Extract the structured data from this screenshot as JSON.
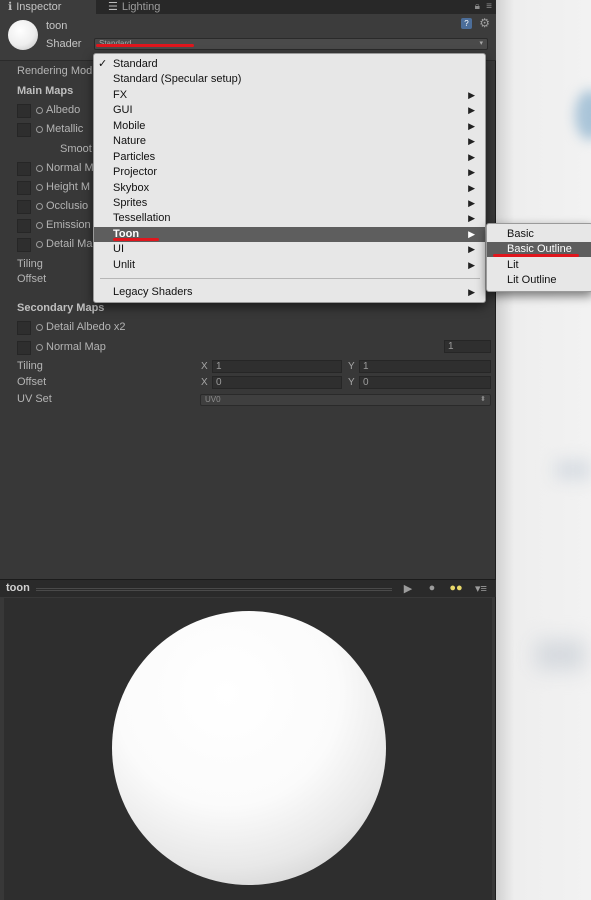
{
  "tabs": [
    {
      "label": "Inspector",
      "icon": "info-icon"
    },
    {
      "label": "Lighting",
      "icon": "lighting-icon"
    }
  ],
  "material": {
    "name": "toon",
    "shader_label": "Shader",
    "shader_value": "Standard"
  },
  "properties": {
    "rendering_mode": "Rendering Mod",
    "main_maps_title": "Main Maps",
    "albedo": "Albedo",
    "metallic": "Metallic",
    "smoothness": "Smoot",
    "normal_map": "Normal M",
    "height_map": "Height M",
    "occlusion": "Occlusio",
    "emission": "Emission",
    "detail_mask": "Detail Ma",
    "tiling": "Tiling",
    "offset": "Offset"
  },
  "secondary": {
    "title": "Secondary Maps",
    "detail_albedo": "Detail Albedo x2",
    "normal_map": "Normal Map",
    "normal_scale": "1",
    "tiling_label": "Tiling",
    "offset_label": "Offset",
    "x_axis": "X",
    "y_axis": "Y",
    "tiling_x": "1",
    "tiling_y": "1",
    "offset_x": "0",
    "offset_y": "0",
    "uv_set_label": "UV Set",
    "uv_set_value": "UV0"
  },
  "shader_menu": {
    "items": [
      {
        "label": "Standard",
        "checked": true,
        "submenu": false
      },
      {
        "label": "Standard (Specular setup)",
        "checked": false,
        "submenu": false
      },
      {
        "label": "FX",
        "submenu": true
      },
      {
        "label": "GUI",
        "submenu": true
      },
      {
        "label": "Mobile",
        "submenu": true
      },
      {
        "label": "Nature",
        "submenu": true
      },
      {
        "label": "Particles",
        "submenu": true
      },
      {
        "label": "Projector",
        "submenu": true
      },
      {
        "label": "Skybox",
        "submenu": true
      },
      {
        "label": "Sprites",
        "submenu": true
      },
      {
        "label": "Tessellation",
        "submenu": true
      },
      {
        "label": "Toon",
        "submenu": true,
        "highlighted": true
      },
      {
        "label": "UI",
        "submenu": true
      },
      {
        "label": "Unlit",
        "submenu": true
      }
    ],
    "legacy": "Legacy Shaders",
    "check_glyph": "✓",
    "arrow_glyph": "▶"
  },
  "toon_submenu": {
    "items": [
      "Basic",
      "Basic Outline",
      "Lit",
      "Lit Outline"
    ],
    "highlighted": "Basic Outline"
  },
  "preview": {
    "title": "toon"
  },
  "colors": {
    "highlight": "#5e5e5e",
    "annotation_red": "#e0161d",
    "panel_bg": "#383838"
  }
}
